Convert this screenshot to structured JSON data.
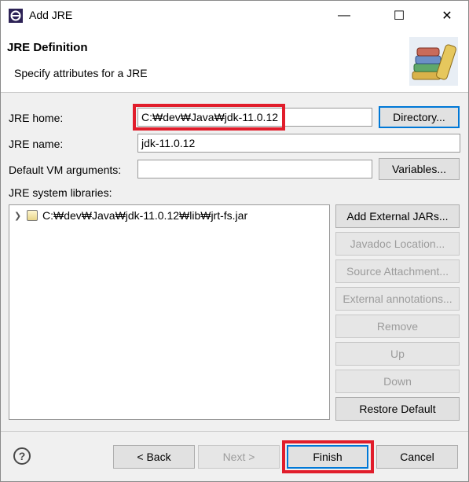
{
  "window": {
    "title": "Add JRE",
    "minimize_glyph": "—",
    "maximize_glyph": "☐",
    "close_glyph": "✕"
  },
  "header": {
    "title": "JRE Definition",
    "subtitle": "Specify attributes for a JRE"
  },
  "form": {
    "jre_home_label": "JRE home:",
    "jre_home_value": "C:\\dev\\Java\\jdk-11.0.12",
    "jre_home_display": "C:₩dev₩Java₩jdk-11.0.12",
    "directory_button": "Directory...",
    "jre_name_label": "JRE name:",
    "jre_name_value": "jdk-11.0.12",
    "vm_args_label": "Default VM arguments:",
    "vm_args_value": "",
    "variables_button": "Variables...",
    "libraries_label": "JRE system libraries:"
  },
  "libraries": {
    "items": [
      {
        "label": "C:₩dev₩Java₩jdk-11.0.12₩lib₩jrt-fs.jar"
      }
    ]
  },
  "library_buttons": {
    "add_external_jars": "Add External JARs...",
    "javadoc_location": "Javadoc Location...",
    "source_attachment": "Source Attachment...",
    "external_annotations": "External annotations...",
    "remove": "Remove",
    "up": "Up",
    "down": "Down",
    "restore_default": "Restore Default"
  },
  "footer": {
    "help_glyph": "?",
    "back_button": "< Back",
    "next_button": "Next >",
    "finish_button": "Finish",
    "cancel_button": "Cancel"
  },
  "colors": {
    "highlight": "#e11d2b",
    "focus": "#0078d7"
  }
}
